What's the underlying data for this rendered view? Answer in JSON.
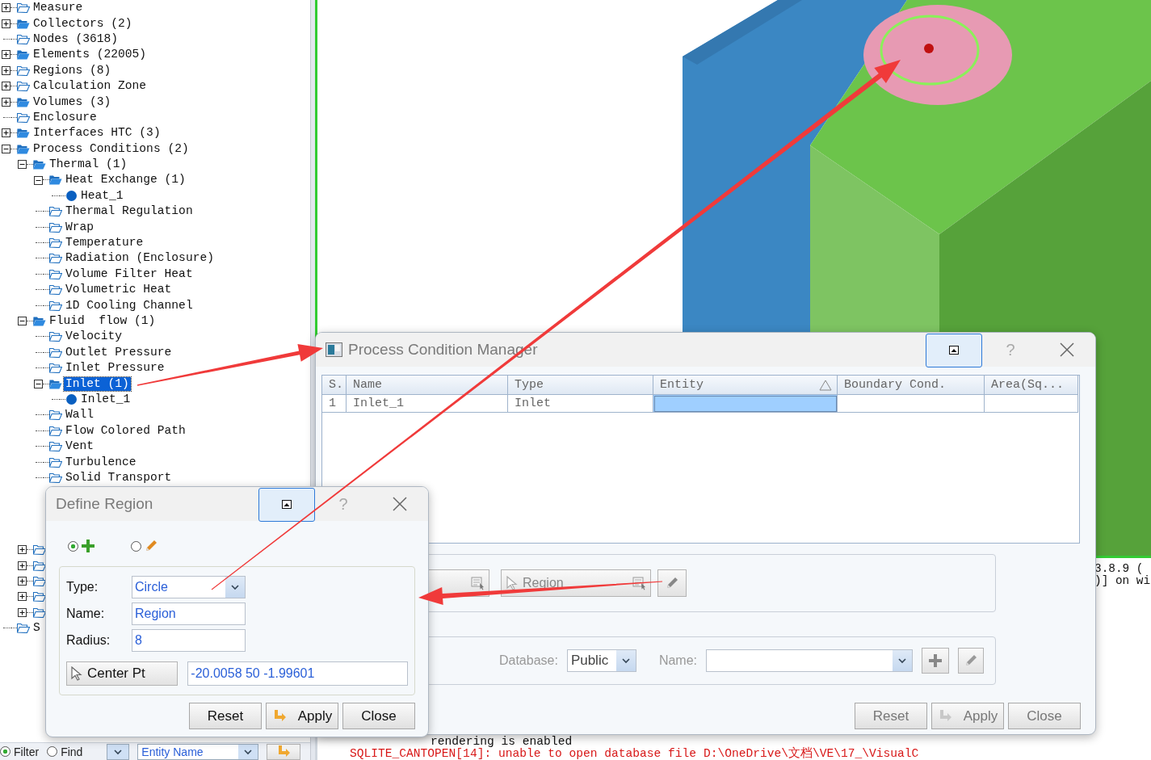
{
  "tree": [
    {
      "label": "Measure",
      "kind": "folder-empty",
      "expanded": false,
      "selected": false
    },
    {
      "label": "Collectors (2)",
      "kind": "folder-filled",
      "expanded": false,
      "selected": false
    },
    {
      "label": "Nodes (3618)",
      "kind": "folder-empty",
      "selected": false
    },
    {
      "label": "Elements (22005)",
      "kind": "folder-filled",
      "expanded": false,
      "selected": false
    },
    {
      "label": "Regions (8)",
      "kind": "folder-empty",
      "expanded": false,
      "selected": false
    },
    {
      "label": "Calculation Zone",
      "kind": "folder-empty",
      "expanded": false,
      "selected": false
    },
    {
      "label": "Volumes (3)",
      "kind": "folder-filled",
      "expanded": false,
      "selected": false
    },
    {
      "label": "Enclosure",
      "kind": "folder-empty",
      "selected": false
    },
    {
      "label": "Interfaces HTC (3)",
      "kind": "folder-filled",
      "expanded": false,
      "selected": false
    },
    {
      "label": "Process Conditions (2)",
      "kind": "folder-filled",
      "expanded": true,
      "selected": false,
      "children": [
        {
          "label": "Thermal (1)",
          "kind": "folder-filled",
          "expanded": true,
          "selected": false,
          "children": [
            {
              "label": "Heat Exchange (1)",
              "kind": "folder-filled",
              "expanded": true,
              "selected": false,
              "children": [
                {
                  "label": "Heat_1",
                  "kind": "dot",
                  "selected": false
                }
              ]
            },
            {
              "label": "Thermal Regulation",
              "kind": "folder-empty",
              "selected": false
            },
            {
              "label": "Wrap",
              "kind": "folder-empty",
              "selected": false
            },
            {
              "label": "Temperature",
              "kind": "folder-empty",
              "selected": false
            },
            {
              "label": "Radiation (Enclosure)",
              "kind": "folder-empty",
              "selected": false
            },
            {
              "label": "Volume Filter Heat",
              "kind": "folder-empty",
              "selected": false
            },
            {
              "label": "Volumetric Heat",
              "kind": "folder-empty",
              "selected": false
            },
            {
              "label": "1D Cooling Channel",
              "kind": "folder-empty",
              "selected": false
            }
          ]
        },
        {
          "label": "Fluid  flow (1)",
          "kind": "folder-filled",
          "expanded": true,
          "selected": false,
          "children": [
            {
              "label": "Velocity",
              "kind": "folder-empty",
              "selected": false
            },
            {
              "label": "Outlet Pressure",
              "kind": "folder-empty",
              "selected": false
            },
            {
              "label": "Inlet Pressure",
              "kind": "folder-empty",
              "selected": false
            },
            {
              "label": "Inlet (1)",
              "kind": "folder-filled",
              "expanded": true,
              "selected": true,
              "children": [
                {
                  "label": "Inlet_1",
                  "kind": "dot",
                  "selected": false
                }
              ]
            },
            {
              "label": "Wall",
              "kind": "folder-empty",
              "selected": false
            },
            {
              "label": "Flow Colored Path",
              "kind": "folder-empty",
              "selected": false
            },
            {
              "label": "Vent",
              "kind": "folder-empty",
              "selected": false
            },
            {
              "label": "Turbulence",
              "kind": "folder-empty",
              "selected": false
            },
            {
              "label": "Solid Transport",
              "kind": "folder-empty",
              "selected": false
            }
          ]
        },
        {
          "kind": "folder-empty",
          "expanded": false
        },
        {
          "kind": "folder-empty",
          "expanded": false
        },
        {
          "kind": "folder-empty",
          "expanded": false
        },
        {
          "kind": "folder-empty",
          "expanded": false
        },
        {
          "kind": "folder-empty",
          "expanded": false
        }
      ]
    },
    {
      "label": "S",
      "kind": "folder-empty",
      "selected": false
    }
  ],
  "filter_bar": {
    "modes": [
      {
        "label": "Filter",
        "selected": true
      },
      {
        "label": "Find",
        "selected": false
      }
    ],
    "field": {
      "value": "Entity Name"
    }
  },
  "console": {
    "right_lines": [
      "3.8.9 (",
      ")] on wi"
    ],
    "lines": [
      {
        "text": "rendering is enabled",
        "kind": "info"
      },
      {
        "text": "SQLITE_CANTOPEN[14]: unable to open database file D:\\OneDrive\\文档\\VE\\17_\\VisualC",
        "kind": "error"
      }
    ]
  },
  "process_condition_manager": {
    "title": "Process Condition Manager",
    "help": "?",
    "table": {
      "columns": [
        {
          "label": "S.",
          "sorted": false
        },
        {
          "label": "Name",
          "sorted": false
        },
        {
          "label": "Type",
          "sorted": false
        },
        {
          "label": "Entity",
          "sorted": true
        },
        {
          "label": "Boundary Cond.",
          "sorted": false
        },
        {
          "label": "Area(Sq...",
          "sorted": false
        }
      ],
      "rows": [
        {
          "cells": [
            {
              "text": "1",
              "selected": false
            },
            {
              "text": "Inlet_1",
              "selected": false
            },
            {
              "text": "Inlet",
              "selected": false
            },
            {
              "selected": true
            },
            {
              "selected": false
            },
            {
              "selected": false
            }
          ]
        }
      ]
    },
    "picker": {
      "label": "Region"
    },
    "database": {
      "label": "Database:",
      "value": "Public"
    },
    "name": {
      "label": "Name:"
    },
    "buttons": [
      {
        "label": "Reset",
        "icon": false
      },
      {
        "label": "Apply",
        "icon": true
      },
      {
        "label": "Close",
        "icon": false
      }
    ]
  },
  "define_region": {
    "title": "Define Region",
    "help": "?",
    "modes": [
      {
        "kind": "add",
        "selected": true
      },
      {
        "kind": "edit",
        "selected": false
      }
    ],
    "fields": [
      {
        "label": "Type:",
        "value": "Circle",
        "kind": "dropdown"
      },
      {
        "label": "Name:",
        "value": "Region",
        "kind": "text"
      },
      {
        "label": "Radius:",
        "value": "8",
        "kind": "text"
      }
    ],
    "center_point": {
      "button": "Center Pt",
      "value": "-20.0058 50 -1.99601"
    },
    "buttons": [
      {
        "label": "Reset",
        "icon": false
      },
      {
        "label": "Apply",
        "icon": true
      },
      {
        "label": "Close",
        "icon": false
      }
    ]
  }
}
